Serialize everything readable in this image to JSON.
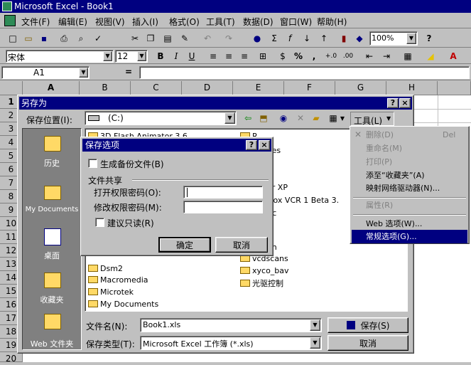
{
  "window": {
    "title": "Microsoft Excel - Book1"
  },
  "menubar": [
    "文件(F)",
    "编辑(E)",
    "视图(V)",
    "插入(I)",
    "格式(O)",
    "工具(T)",
    "数据(D)",
    "窗口(W)",
    "帮助(H)"
  ],
  "toolbar": {
    "zoom": "100%"
  },
  "format_bar": {
    "font": "宋体",
    "size": "12",
    "bold": "B",
    "italic": "I",
    "underline": "U",
    "percent": "%",
    "comma": ","
  },
  "formula_bar": {
    "name_box": "A1",
    "equals": "="
  },
  "columns": [
    "A",
    "B",
    "C",
    "D",
    "E",
    "F",
    "G",
    "H"
  ],
  "rows": [
    "1",
    "2",
    "3",
    "4",
    "5",
    "6",
    "7",
    "8",
    "9",
    "10",
    "11",
    "12",
    "13",
    "14",
    "15",
    "16",
    "17",
    "18",
    "19",
    "20"
  ],
  "save_dialog": {
    "title": "另存为",
    "help": "?",
    "save_in_label": "保存位置(I):",
    "save_in_value": "(C:)",
    "tools_label": "工具(L)",
    "places": [
      "历史",
      "My Documents",
      "桌面",
      "收藏夹",
      "Web 文件夹"
    ],
    "files_left": [
      "3D Flash Animator 3.6",
      "Macromedia",
      "Microtek",
      "My Documents",
      "Dsm2"
    ],
    "files_right": [
      "R",
      "am Files",
      "car XP",
      "nBox VCR 1 Beta 3.",
      "voc",
      "e",
      "can",
      "xyco_bav",
      "光驱控制",
      "vcdscans"
    ],
    "filename_label": "文件名(N):",
    "filename_value": "Book1.xls",
    "filetype_label": "保存类型(T):",
    "filetype_value": "Microsoft Excel 工作簿 (*.xls)",
    "save_button": "保存(S)",
    "cancel_button": "取消"
  },
  "options_dialog": {
    "title": "保存选项",
    "backup_label": "生成备份文件(B)",
    "share_group": "文件共享",
    "open_pwd_label": "打开权限密码(O):",
    "modify_pwd_label": "修改权限密码(M):",
    "readonly_label": "建议只读(R)",
    "ok_button": "确定",
    "cancel_button": "取消"
  },
  "tools_menu": {
    "items": [
      {
        "label": "删除(D)",
        "shortcut": "Del",
        "disabled": true
      },
      {
        "label": "重命名(M)",
        "disabled": true
      },
      {
        "label": "打印(P)",
        "disabled": true
      },
      {
        "label": "添至“收藏夹”(A)",
        "disabled": false
      },
      {
        "label": "映射网络驱动器(N)...",
        "disabled": false
      },
      {
        "label": "属性(R)",
        "disabled": true
      },
      {
        "label": "Web 选项(W)...",
        "disabled": false
      },
      {
        "label": "常规选项(G)...",
        "disabled": false,
        "highlighted": true
      }
    ]
  },
  "colors": {
    "title_bar": "#000080",
    "highlight": "#000080",
    "face": "#c0c0c0",
    "disabled_text": "#808080"
  }
}
